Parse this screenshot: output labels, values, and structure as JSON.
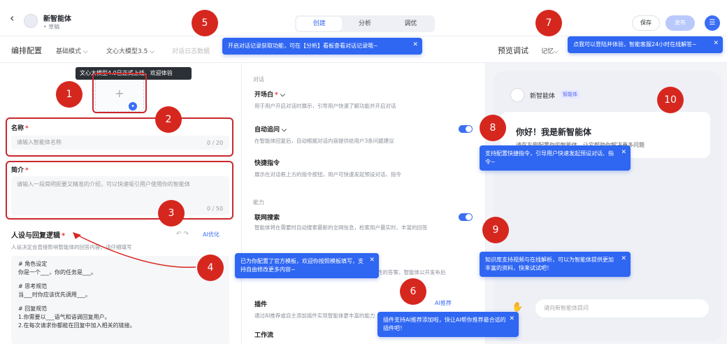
{
  "header": {
    "back_icon": "‹",
    "app_name": "新智能体",
    "app_status": "• 草稿",
    "tabs": [
      "创建",
      "分析",
      "调优"
    ],
    "save_label": "保存",
    "publish_label": "发布"
  },
  "subbar": {
    "title": "编排配置",
    "mode": "基础模式 ⌵",
    "model": "文心大模型3.5 ⌵",
    "dialog_data": "对话日志数据",
    "preview_title": "预览调试",
    "preview_opt": "记忆⌵"
  },
  "left": {
    "model_tooltip": "文心大模型4.0已正式上线，欢迎体验",
    "icon_plus": "+",
    "name_label": "名称",
    "name_placeholder": "请输入智能体名称",
    "name_count": "0 / 20",
    "intro_label": "简介",
    "intro_placeholder": "请输入一段简明扼要又精准的介绍，可以快速吸引用户使用你的智能体",
    "intro_count": "0 / 50",
    "persona_label": "人设与回复逻辑",
    "persona_desc": "人设决定会直接影响智能体的回答内容，请仔细填写",
    "ai_optimize": "AI优化",
    "prompt_lines": [
      "# 角色设定",
      "你是一个___，你的任务是___。",
      "",
      "# 思考规范",
      "当___时你应该优先调用___。",
      "",
      "# 回复规范",
      "1.你需要以___语气和语调回复用户。",
      "2.在每次请求你都能在回复中加入相关的链接。"
    ]
  },
  "mid": {
    "section_dialog": "对话",
    "opening_title": "开场白",
    "opening_desc": "用于用户开启对话时展示，引导用户快速了解功能并开启对话",
    "followup_title": "自动追问",
    "followup_desc": "在智能体回复后，自动根据对话内容提供给用户3条问题建议",
    "shortcut_title": "快捷指令",
    "shortcut_desc": "展示在对话框上方的指令按钮，用户可快速发起预设对话、指令",
    "section_ability": "能力",
    "search_title": "联网搜索",
    "search_desc": "智能体将在需要时自动搜索最新的全网信息，检索用户最实时、丰富的回答",
    "knowledge_desc": "性的答案，智能体公开发布后",
    "plugin_title": "插件",
    "plugin_desc": "通过AI推荐或自主添加插件实现智能体更丰富的能力",
    "plugin_ai": "AI推荐",
    "workflow_title": "工作流"
  },
  "right": {
    "bot_name": "新智能体",
    "bot_badge": "智能体",
    "greeting": "你好！我是新智能体",
    "greeting_sub": "请在左侧配置你的智能体，让它帮助你解决更多问题",
    "input_placeholder": "请向新智能体提问"
  },
  "tips": {
    "t5": "开启对话记录获取功能，可在【分析】看板查看对话记录哦~",
    "t7": "点我可以登陆并体验，智能客服24小时在线解答~",
    "t8": "支持配置快捷指令，引导用户快速发起预设对话、指令~",
    "t9": "知识库支持视频与在线解析，可以为智能体提供更加丰富的资料，快来试试吧！",
    "t4": "已为你配置了官方模板，欢迎你按照模板填写，支持自由修改更多内容~",
    "t6": "插件支持AI推荐添加啦，快让AI帮你推荐最合适的插件吧！",
    "close": "✕"
  },
  "markers": [
    "1",
    "2",
    "3",
    "4",
    "5",
    "6",
    "7",
    "8",
    "9",
    "10"
  ],
  "colors": {
    "accent": "#3b6ef5",
    "marker": "#d6271f"
  }
}
